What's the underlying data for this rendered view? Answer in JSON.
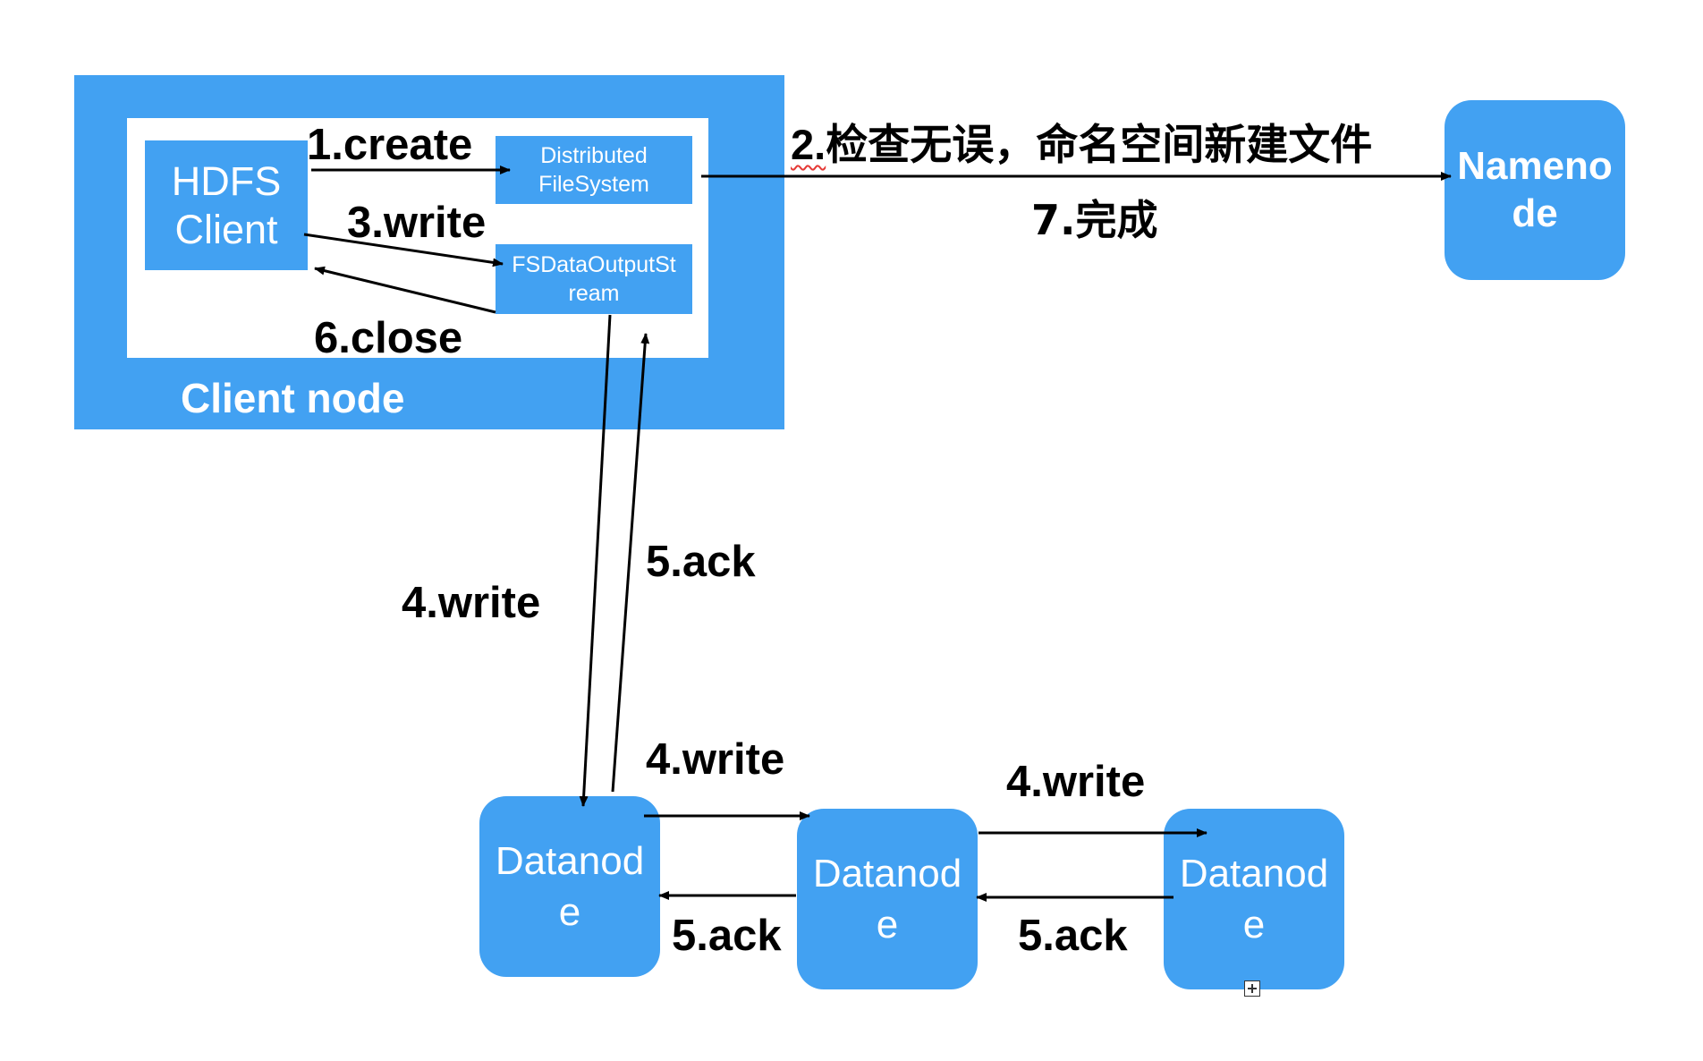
{
  "client_node": {
    "label": "Client node",
    "hdfs_client": "HDFS\nClient",
    "distributed_fs": "Distributed\nFileSystem",
    "fs_output_stream": "FSDataOutputSt\nream"
  },
  "namenode": {
    "label": "Nameno\nde"
  },
  "datanodes": [
    {
      "label": "Datanod\ne"
    },
    {
      "label": "Datanod\ne"
    },
    {
      "label": "Datanod\ne"
    }
  ],
  "steps": {
    "create": "1.create",
    "check_num": "2.",
    "check_text": "检查无误，命名空间新建文件",
    "write_client": "3.write",
    "write_pipeline_a": "4.write",
    "write_pipeline_b": "4.write",
    "write_pipeline_c": "4.write",
    "ack_a": "5.ack",
    "ack_b": "5.ack",
    "ack_c": "5.ack",
    "close": "6.close",
    "complete": "7.完成"
  },
  "colors": {
    "node_fill": "#42a1f2",
    "arrow": "#000000"
  },
  "icons": {
    "expand": "plus-box-icon"
  }
}
